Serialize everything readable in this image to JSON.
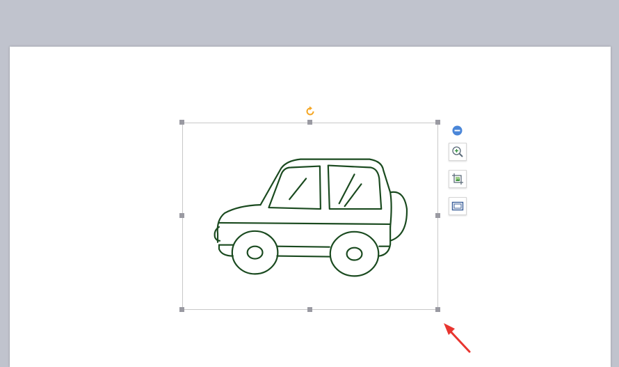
{
  "canvas": {
    "background": "#c0c3cd",
    "page_color": "#ffffff"
  },
  "image": {
    "subject": "car-drawing",
    "stroke_color": "#1a4a1f"
  },
  "selection": {
    "border_color": "#c8c8c8",
    "handle_color": "#9a9aa2"
  },
  "rotate_handle": {
    "icon": "rotate-icon",
    "color": "#f5a623"
  },
  "side_toolbar": {
    "collapse_icon": "minus-circle-icon",
    "collapse_color": "#4a86d8",
    "tools": [
      {
        "icon": "zoom-in-icon"
      },
      {
        "icon": "crop-image-icon"
      },
      {
        "icon": "border-frame-icon"
      }
    ]
  },
  "annotation": {
    "icon": "red-arrow",
    "color": "#e8352f"
  }
}
